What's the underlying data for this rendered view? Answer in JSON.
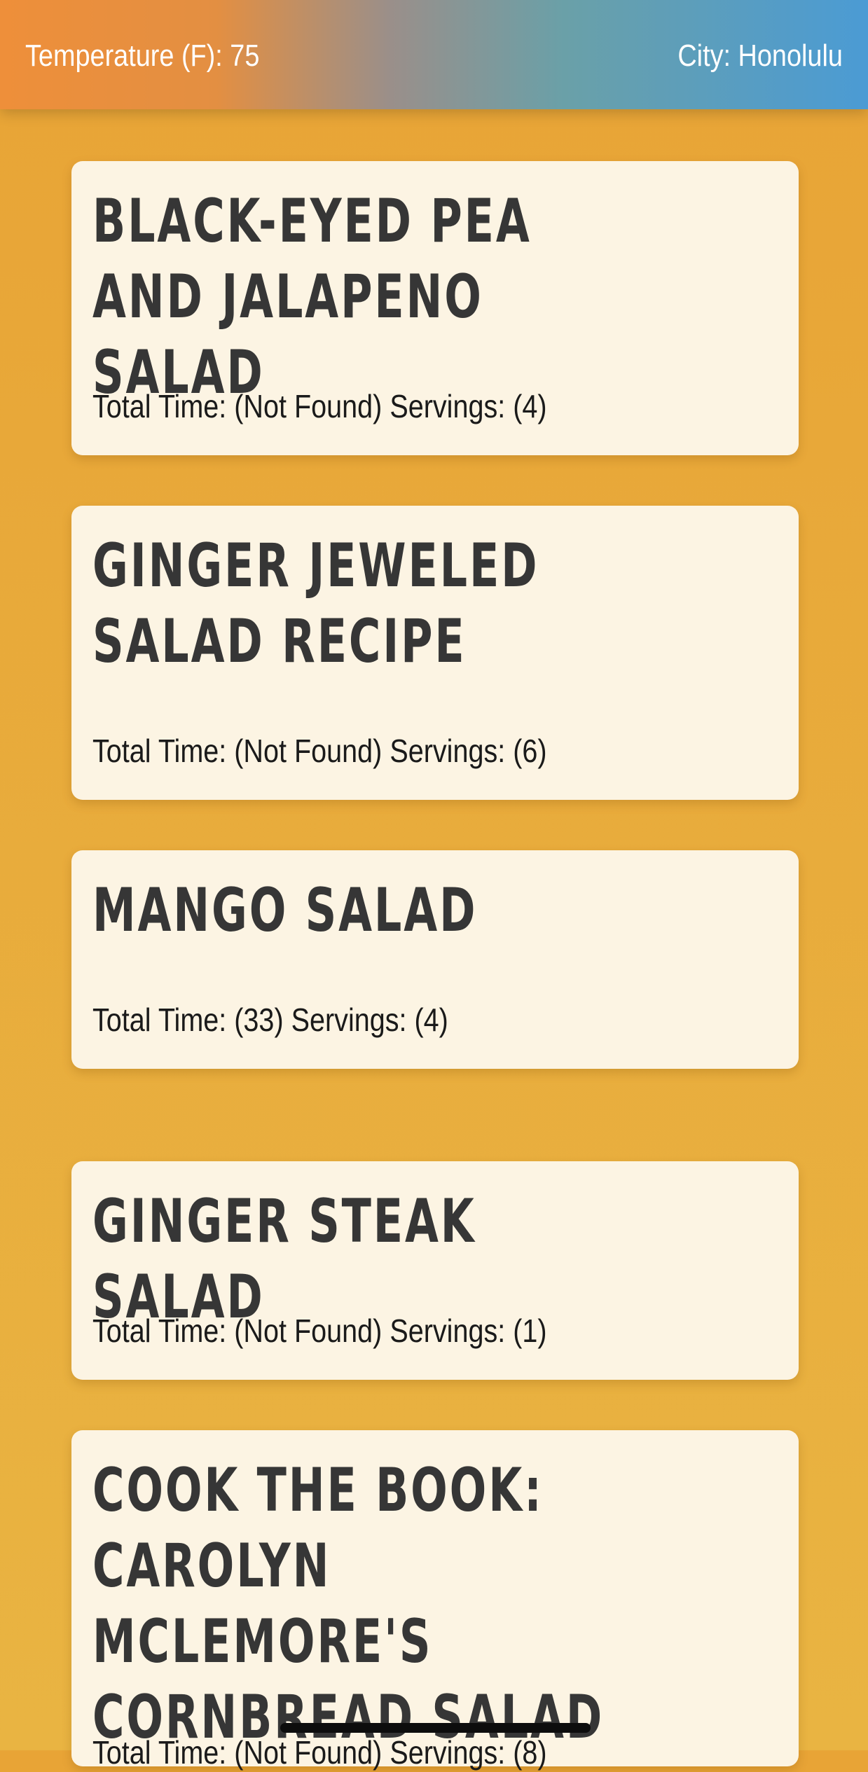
{
  "header": {
    "temperature": "Temperature (F): 75",
    "city": "City: Honolulu"
  },
  "recipes": [
    {
      "title": "BLACK-EYED PEA AND JALAPENO SALAD",
      "meta": "Total Time: (Not Found) Servings: (4)"
    },
    {
      "title": "GINGER JEWELED SALAD RECIPE",
      "meta": "Total Time: (Not Found) Servings: (6)"
    },
    {
      "title": "MANGO SALAD",
      "meta": "Total Time: (33) Servings: (4)"
    },
    {
      "title": "GINGER STEAK SALAD",
      "meta": "Total Time: (Not Found) Servings: (1)"
    },
    {
      "title": "COOK THE BOOK: CAROLYN MCLEMORE'S CORNBREAD SALAD",
      "meta": "Total Time: (Not Found) Servings: (8)"
    }
  ]
}
